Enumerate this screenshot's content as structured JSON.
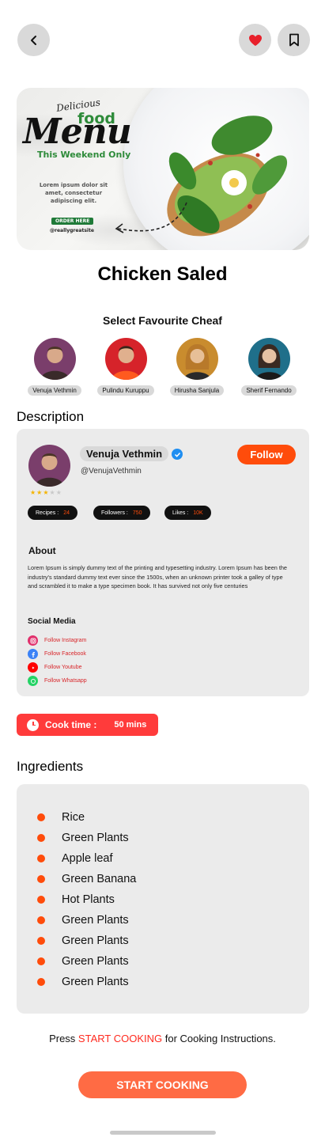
{
  "header": {
    "back_icon": "chevron-left-icon",
    "favorite_icon": "heart-icon",
    "bookmark_icon": "bookmark-icon",
    "favorite_color": "#e8202b"
  },
  "hero": {
    "script_text": "Delicious",
    "food_text": "food",
    "menu_text": "Menu",
    "weekend_text": "This Weekend Only",
    "body_text": "Lorem ipsum dolor sit amet, consectetur adipiscing elit.",
    "order_label": "ORDER HERE",
    "site_text": "@reallygreatsite"
  },
  "title": "Chicken Saled",
  "chefs": {
    "heading": "Select Favourite Cheaf",
    "items": [
      {
        "name": "Venuja Vethmin",
        "color": "#7a3e6b"
      },
      {
        "name": "Pulindu Kuruppu",
        "color": "#d6232a"
      },
      {
        "name": "Hirusha Sanjula",
        "color": "#c98c2e"
      },
      {
        "name": "Sherif Fernando",
        "color": "#1f6f8a"
      }
    ]
  },
  "description": {
    "heading": "Description",
    "chef_name": "Venuja Vethmin",
    "handle": "@VenujaVethmin",
    "follow_label": "Follow",
    "rating": 3,
    "rating_max": 5,
    "stats": {
      "recipes_label": "Recipes :",
      "recipes_value": "24",
      "followers_label": "Followers :",
      "followers_value": "750",
      "likes_label": "Likes :",
      "likes_value": "10K"
    },
    "about_heading": "About",
    "about_text": "Lorem Ipsum is simply dummy text of the printing and typesetting industry. Lorem Ipsum has been the industry's standard dummy text ever since the 1500s, when an unknown printer took a galley of type and scrambled it to make a type specimen book. It has survived not only five centuries",
    "social_heading": "Social Media",
    "social": [
      {
        "label": "Follow Instagram",
        "icon": "instagram-icon",
        "color": "#e1306c"
      },
      {
        "label": "Follow Facebook",
        "icon": "facebook-icon",
        "color": "#3b82f6"
      },
      {
        "label": "Follow Youtube",
        "icon": "youtube-icon",
        "color": "#ff0000"
      },
      {
        "label": "Follow Whatsapp",
        "icon": "whatsapp-icon",
        "color": "#25d366"
      }
    ]
  },
  "cook_time": {
    "label": "Cook time  :",
    "value": "50 mins",
    "icon": "clock-icon"
  },
  "ingredients": {
    "heading": "Ingredients",
    "items": [
      "Rice",
      "Green Plants",
      "Apple leaf",
      "Green Banana",
      "Hot Plants",
      "Green Plants",
      "Green Plants",
      "Green Plants",
      "Green Plants"
    ]
  },
  "instructions": {
    "prefix": "Press ",
    "highlight": "START COOKING",
    "suffix": " for Cooking Instructions."
  },
  "start_button": "START COOKING",
  "colors": {
    "accent": "#ff4c0b",
    "start_button": "#ff6b44",
    "cook_badge": "#ff3b3b"
  }
}
